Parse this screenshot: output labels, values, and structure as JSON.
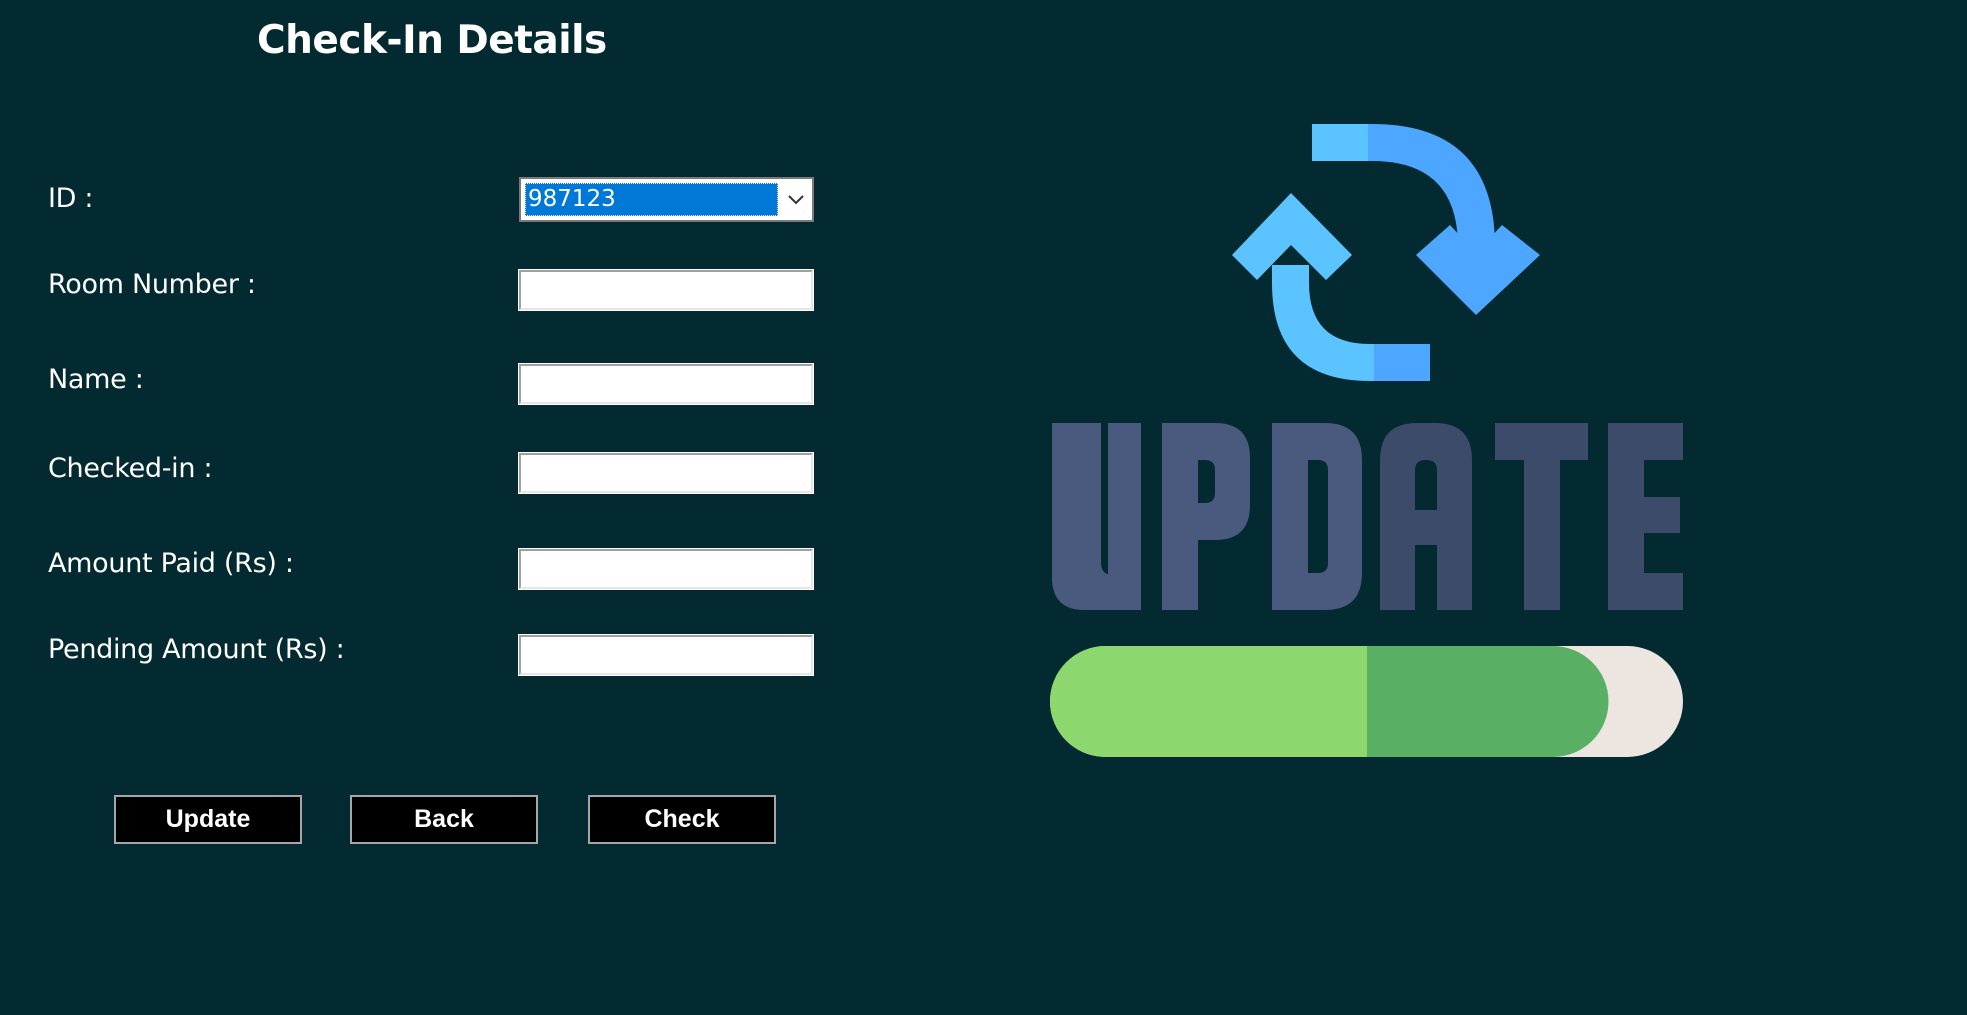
{
  "header": {
    "title": "Check-In Details"
  },
  "form": {
    "id_label": "ID :",
    "id_value": "987123",
    "room_label": "Room Number :",
    "room_value": "",
    "name_label": "Name :",
    "name_value": "",
    "checkin_label": "Checked-in :",
    "checkin_value": "",
    "paid_label": "Amount Paid (Rs) :",
    "paid_value": "",
    "pending_label": "Pending Amount (Rs) :",
    "pending_value": ""
  },
  "buttons": {
    "update_label": "Update",
    "back_label": "Back",
    "check_label": "Check"
  },
  "illustration": {
    "text": "UPDATE",
    "progress_fraction": 0.82,
    "icons": [
      "refresh-icon",
      "progress-bar"
    ],
    "colors": {
      "arrow_light": "#5bc3ff",
      "arrow_dark": "#4da6ff",
      "letters_light": "#4a5a7e",
      "letters_dark": "#3d4b6a",
      "bar_light": "#8cd86f",
      "bar_dark": "#59b065",
      "track": "#ede5e0"
    }
  },
  "theme": {
    "background": "#032a30",
    "selection": "#0078d7"
  }
}
